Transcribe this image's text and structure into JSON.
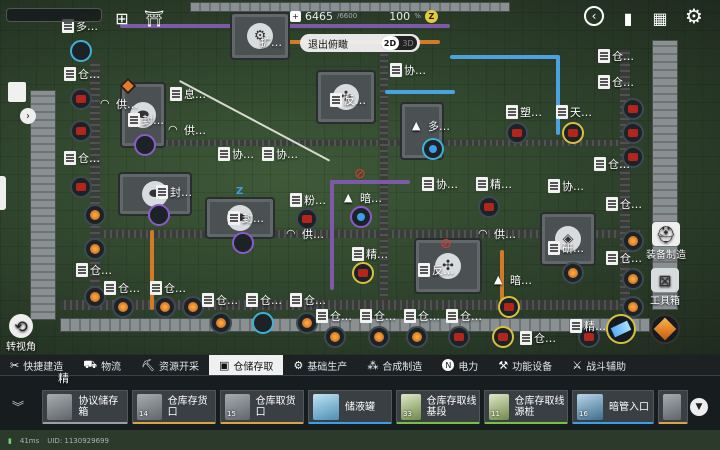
{
  "top": {
    "power_value": "6465",
    "power_max": "/6600",
    "efficiency": "100",
    "efficiency_unit": "%",
    "coin_symbol": "Z",
    "exit_view_label": "退出俯瞰",
    "mode_2d": "2D",
    "mode_3d": "3D"
  },
  "left": {
    "rotate_label": "转视角"
  },
  "right": {
    "equip_label": "装备制造",
    "toolbox_label": "工具箱"
  },
  "map_labels": {
    "duo_top": "多…",
    "cang": "仓…",
    "gong": "供…",
    "feng": "封…",
    "xi": "息…",
    "xie": "协…",
    "fan": "反…",
    "duo": "多…",
    "su": "塑…",
    "tian": "天…",
    "an": "暗…",
    "fen": "粉…",
    "jing": "精…",
    "yan": "研…",
    "kuo": "扩…",
    "jing2": "精…",
    "jing_bottom": "精"
  },
  "categories": [
    {
      "label": "快捷建造",
      "icon": "✂"
    },
    {
      "label": "物流",
      "icon": "⛟"
    },
    {
      "label": "资源开采",
      "icon": "⛏"
    },
    {
      "label": "仓储存取",
      "icon": "▣",
      "active": true
    },
    {
      "label": "基础生产",
      "icon": "⚙"
    },
    {
      "label": "合成制造",
      "icon": "⁂"
    },
    {
      "label": "电力",
      "icon": "N"
    },
    {
      "label": "功能设备",
      "icon": "⚒"
    },
    {
      "label": "战斗辅助",
      "icon": "⚔"
    }
  ],
  "items": [
    {
      "name": "协议储存箱",
      "count": "",
      "accent": "#9aa0a6"
    },
    {
      "name": "仓库存货口",
      "count": "14",
      "accent": "#d9a441"
    },
    {
      "name": "仓库取货口",
      "count": "15",
      "accent": "#d9a441"
    },
    {
      "name": "储液罐",
      "count": "",
      "accent": "#3aa0e8"
    },
    {
      "name": "仓库存取线基段",
      "count": "33",
      "accent": "#7bc043"
    },
    {
      "name": "仓库存取线源桩",
      "count": "11",
      "accent": "#7bc043"
    },
    {
      "name": "暗管入口",
      "count": "16",
      "accent": "#3aa0e8"
    },
    {
      "name": "",
      "count": "",
      "accent": "#d9a441"
    }
  ],
  "footer": {
    "ping": "41ms",
    "uid": "UID: 1130929699"
  }
}
